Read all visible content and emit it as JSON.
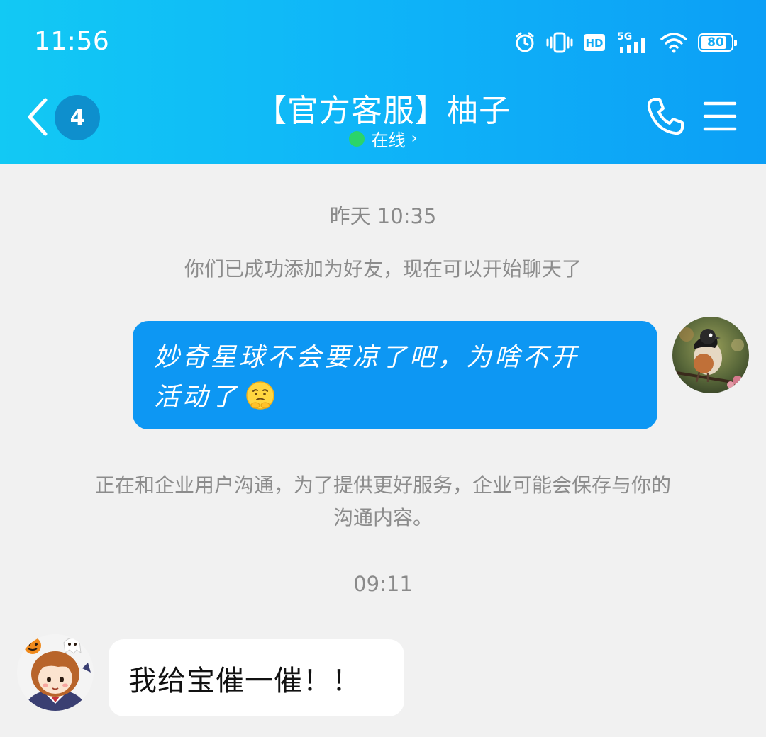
{
  "status_bar": {
    "time": "11:56",
    "network": "5G",
    "hd_label": "HD",
    "battery": "80",
    "icons": [
      "alarm-icon",
      "vibrate-icon",
      "hd-icon",
      "signal-5g-icon",
      "wifi-icon",
      "battery-icon"
    ]
  },
  "header": {
    "back_icon": "chevron-left-icon",
    "unread_count": "4",
    "title": "【官方客服】柚子",
    "status": "在线",
    "status_chevron": "›",
    "call_icon": "phone-icon",
    "menu_icon": "hamburger-menu-icon",
    "accent_color": "#12b8f6"
  },
  "messages": {
    "timestamp_1": "昨天  10:35",
    "system_1": "你们已成功添加为好友，现在可以开始聊天了",
    "outgoing_line_1": "妙奇星球不会要凉了吧，为啥不开",
    "outgoing_line_2": "活动了",
    "outgoing_emoji": "worried-face-emoji",
    "system_2_line_1": "正在和企业用户沟通，为了提供更好服务，企业可能会保存与你的",
    "system_2_line_2": "沟通内容。",
    "timestamp_2": "09:11",
    "incoming_text": "我给宝催一催！！",
    "outgoing_bubble_color": "#0d97f3",
    "incoming_bubble_color": "#ffffff"
  },
  "avatars": {
    "self": "bird-avatar",
    "agent": "cartoon-girl-avatar"
  }
}
